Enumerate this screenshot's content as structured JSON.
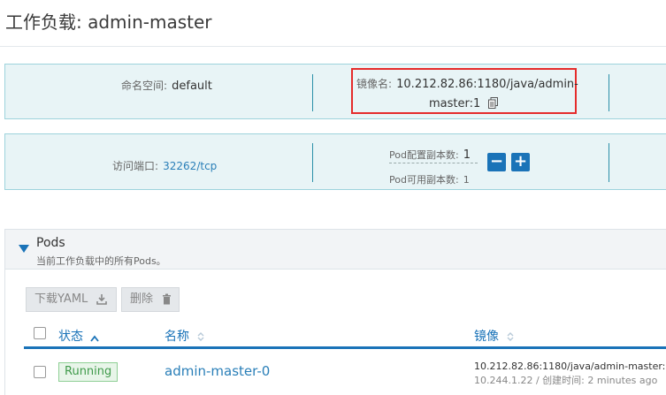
{
  "page": {
    "title": "工作负载: admin-master"
  },
  "panel1": {
    "namespace_label": "命名空间:",
    "namespace_value": "default",
    "image_label": "镜像名:",
    "image_value_line1": "10.212.82.86:1180/java/admin-",
    "image_value_line2": "master:1"
  },
  "panel2": {
    "port_label": "访问端口:",
    "port_value": "32262/tcp",
    "pod_config_label": "Pod配置副本数:",
    "pod_config_value": "1",
    "pod_available_label": "Pod可用副本数:",
    "pod_available_value": "1",
    "minus_label": "−",
    "plus_label": "+"
  },
  "pods": {
    "title": "Pods",
    "subtitle": "当前工作负载中的所有Pods。",
    "toolbar": {
      "download_yaml": "下载YAML",
      "delete": "删除"
    },
    "columns": {
      "status": "状态",
      "name": "名称",
      "image": "镜像"
    },
    "rows": [
      {
        "status": "Running",
        "name": "admin-master-0",
        "image": "10.212.82.86:1180/java/admin-master:1",
        "meta": "10.244.1.22 / 创建时间: 2 minutes ago"
      }
    ]
  },
  "icons": [
    "copy-icon",
    "download-icon",
    "trash-icon",
    "sort-icon",
    "collapse-caret-icon"
  ],
  "colors": {
    "accent": "#1a73b8",
    "highlight_border": "#e52b2b",
    "panel_bg": "#e8f4f6",
    "running_green": "#3f9a4a"
  }
}
